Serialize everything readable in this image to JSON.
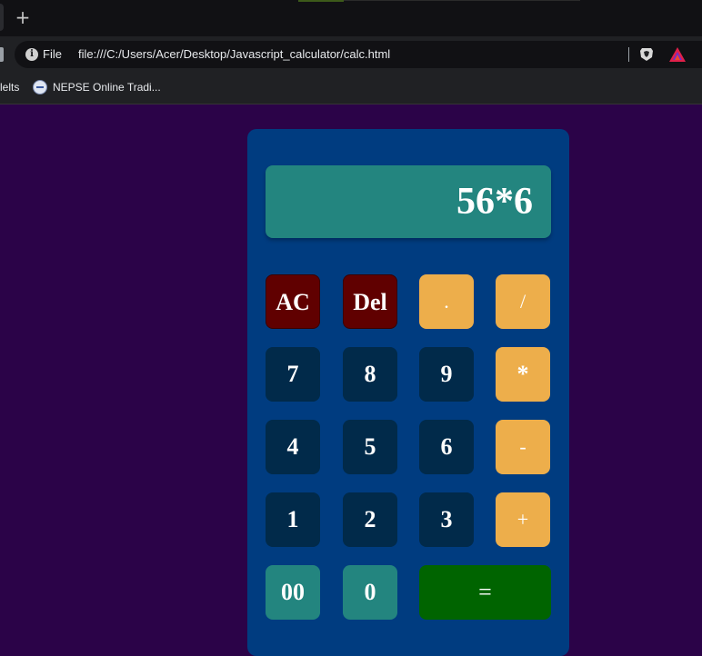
{
  "browser": {
    "new_tab_symbol": "+",
    "scheme_label": "File",
    "url": "file:///C:/Users/Acer/Desktop/Javascript_calculator/calc.html",
    "icons": [
      "info-icon",
      "brave-shield-icon",
      "brave-rewards-icon"
    ],
    "bookmarks": {
      "truncated_label": "lelts",
      "items": [
        {
          "label": "NEPSE Online Tradi..."
        }
      ]
    }
  },
  "calculator": {
    "display_value": "56*6",
    "keys": {
      "clear": "AC",
      "delete": "Del",
      "dot": ".",
      "divide": "/",
      "seven": "7",
      "eight": "8",
      "nine": "9",
      "multiply": "*",
      "four": "4",
      "five": "5",
      "six": "6",
      "subtract": "-",
      "one": "1",
      "two": "2",
      "three": "3",
      "add": "+",
      "double_zero": "00",
      "zero": "0",
      "equals": "="
    }
  },
  "colors": {
    "page_background": "#2b0348",
    "calculator_body": "#003c80",
    "display_background": "#23857f",
    "clear_keys": "#600000",
    "operator_keys": "#edae4b",
    "number_keys": "#012a4a",
    "equals_key": "#006400"
  }
}
